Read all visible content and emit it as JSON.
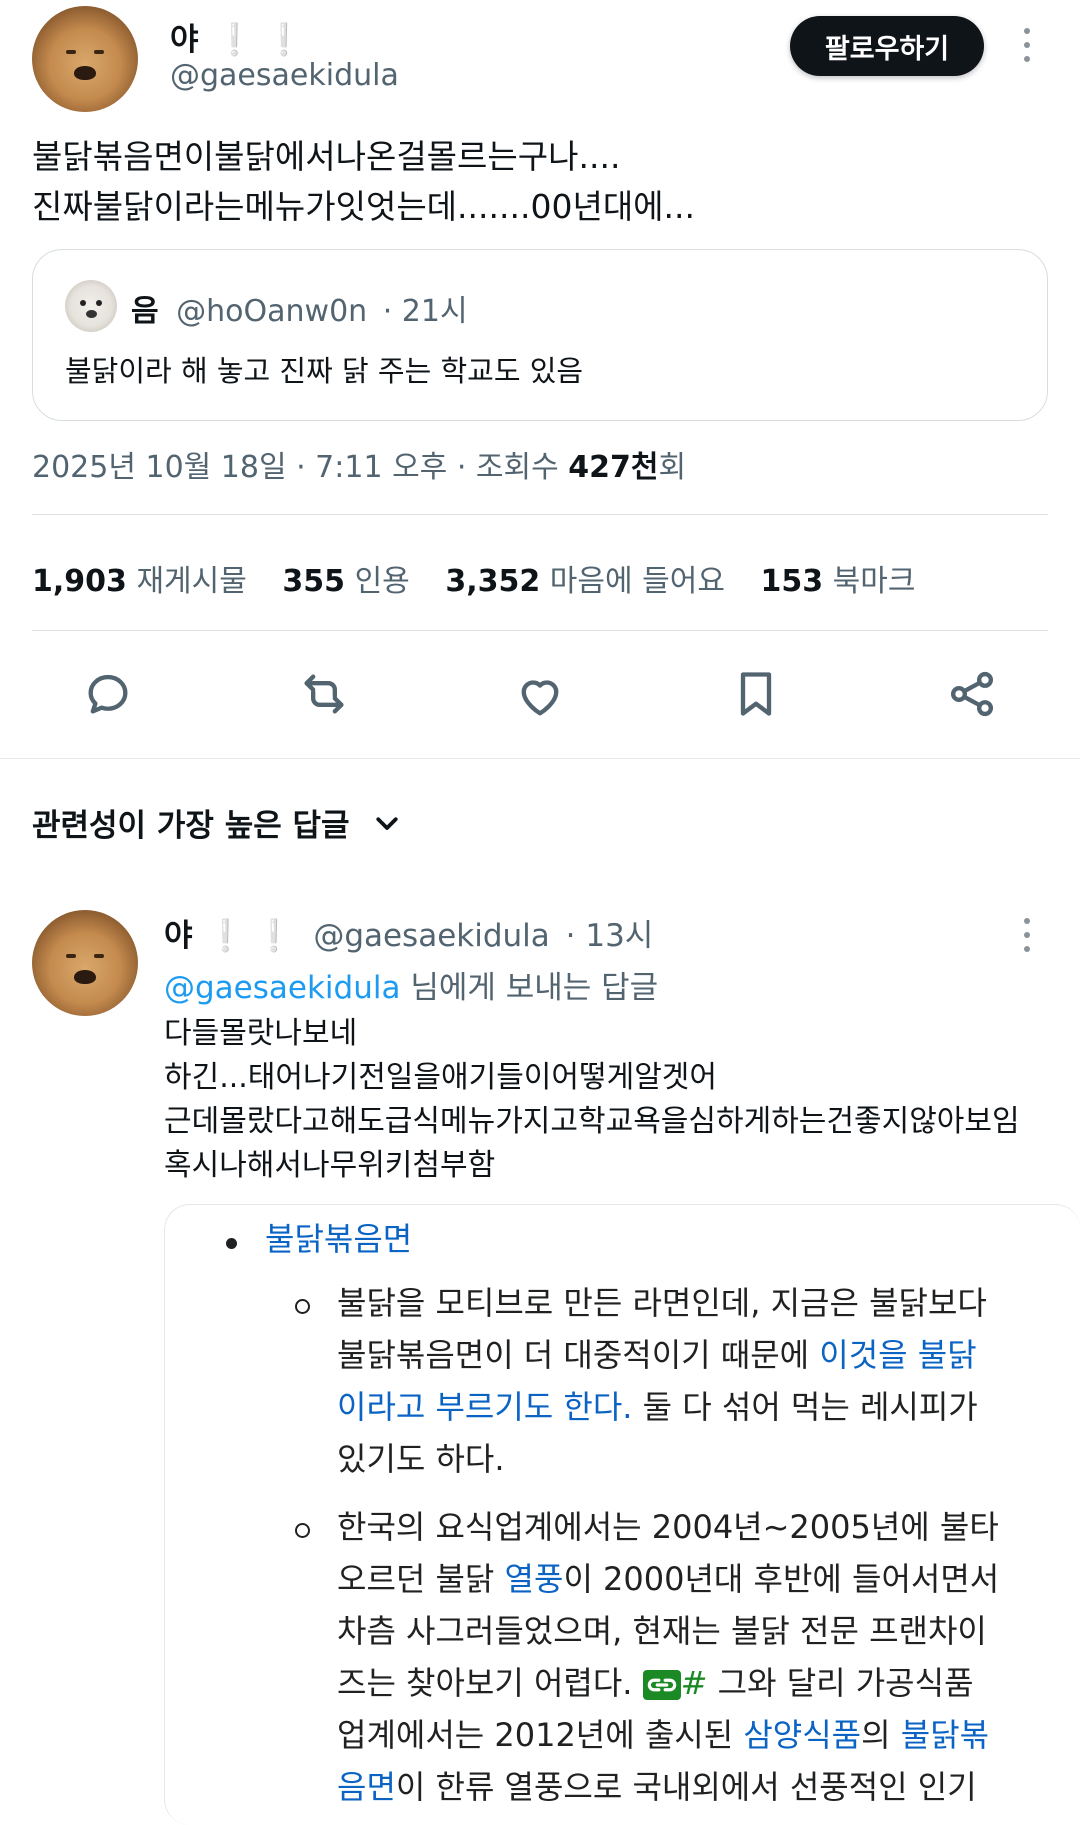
{
  "main_post": {
    "display_name": "야",
    "name_emoji": "❕ ❕",
    "handle": "@gaesaekidula",
    "follow_label": "팔로우하기",
    "text_line1": "불닭볶음면이불닭에서나온걸몰르는구나....",
    "text_line2": "진짜불닭이라는메뉴가잇엇는데.......00년대에..."
  },
  "quote": {
    "display_name": "음",
    "handle": "@hoOanw0n",
    "time": "· 21시",
    "text": "불닭이라 해 놓고 진짜 닭 주는 학교도 있음"
  },
  "meta": {
    "date_time": "2025년 10월 18일 · 7:11 오후 · 조회수 ",
    "views_count": "427천",
    "views_suffix": "회"
  },
  "stats": [
    {
      "count": "1,903",
      "label": "재게시물"
    },
    {
      "count": "355",
      "label": "인용"
    },
    {
      "count": "3,352",
      "label": "마음에 들어요"
    },
    {
      "count": "153",
      "label": "북마크"
    }
  ],
  "actions": [
    "reply-icon",
    "repost-icon",
    "like-icon",
    "bookmark-icon",
    "share-icon"
  ],
  "replies_header": {
    "label": "관련성이 가장 높은 답글",
    "chevron": "chevron-down-icon"
  },
  "reply": {
    "display_name": "야",
    "name_emoji": "❕ ❕",
    "handle": "@gaesaekidula",
    "time": "· 13시",
    "replying_to_handle": "@gaesaekidula",
    "replying_to_suffix": " 님에게 보내는 답글",
    "lines": [
      "다들몰랏나보네",
      "하긴...태어나기전일을애기들이어떻게알겟어",
      "근데몰랐다고해도급식메뉴가지고학교욕을심하게하는건좋지않아보임",
      "혹시나해서나무위키첨부함"
    ],
    "embed": {
      "bullet_title": "불닭볶음면",
      "item1": {
        "line1": "불닭을 모티브로 만든 라면인데, 지금은 불닭보다",
        "line2_a": "불닭볶음면이 더 대중적이기 때문에 ",
        "line2_link": "이것을 불닭",
        "line3_link": "이라고 부르기도 한다.",
        "line3_b": " 둘 다 섞어 먹는 레시피가",
        "line4": "있기도 하다."
      },
      "item2": {
        "line1": "한국의 요식업계에서는 2004년~2005년에 불타",
        "line2_a": "오르던 불닭 ",
        "line2_link": "열풍",
        "line2_b": "이 2000년대 후반에 들어서면서",
        "line3": "차츰 사그러들었으며, 현재는 불닭 전문 프랜차이",
        "line4_a": "즈는 찾아보기 어렵다. ",
        "line4_hash": "#",
        "line4_b": " 그와 달리 가공식품",
        "line5_a": "업계에서는 2012년에 출시된 ",
        "line5_link1": "삼양식품",
        "line5_b": "의 ",
        "line5_link2": "불닭볶",
        "line6_link": "음면",
        "line6_b": "이 한류 열풍으로 국내외에서 선풍적인 인기"
      }
    }
  },
  "colors": {
    "link": "#1d9bf0",
    "wiki_link": "#0b63c4",
    "text": "#0f1419",
    "secondary": "#536471"
  }
}
